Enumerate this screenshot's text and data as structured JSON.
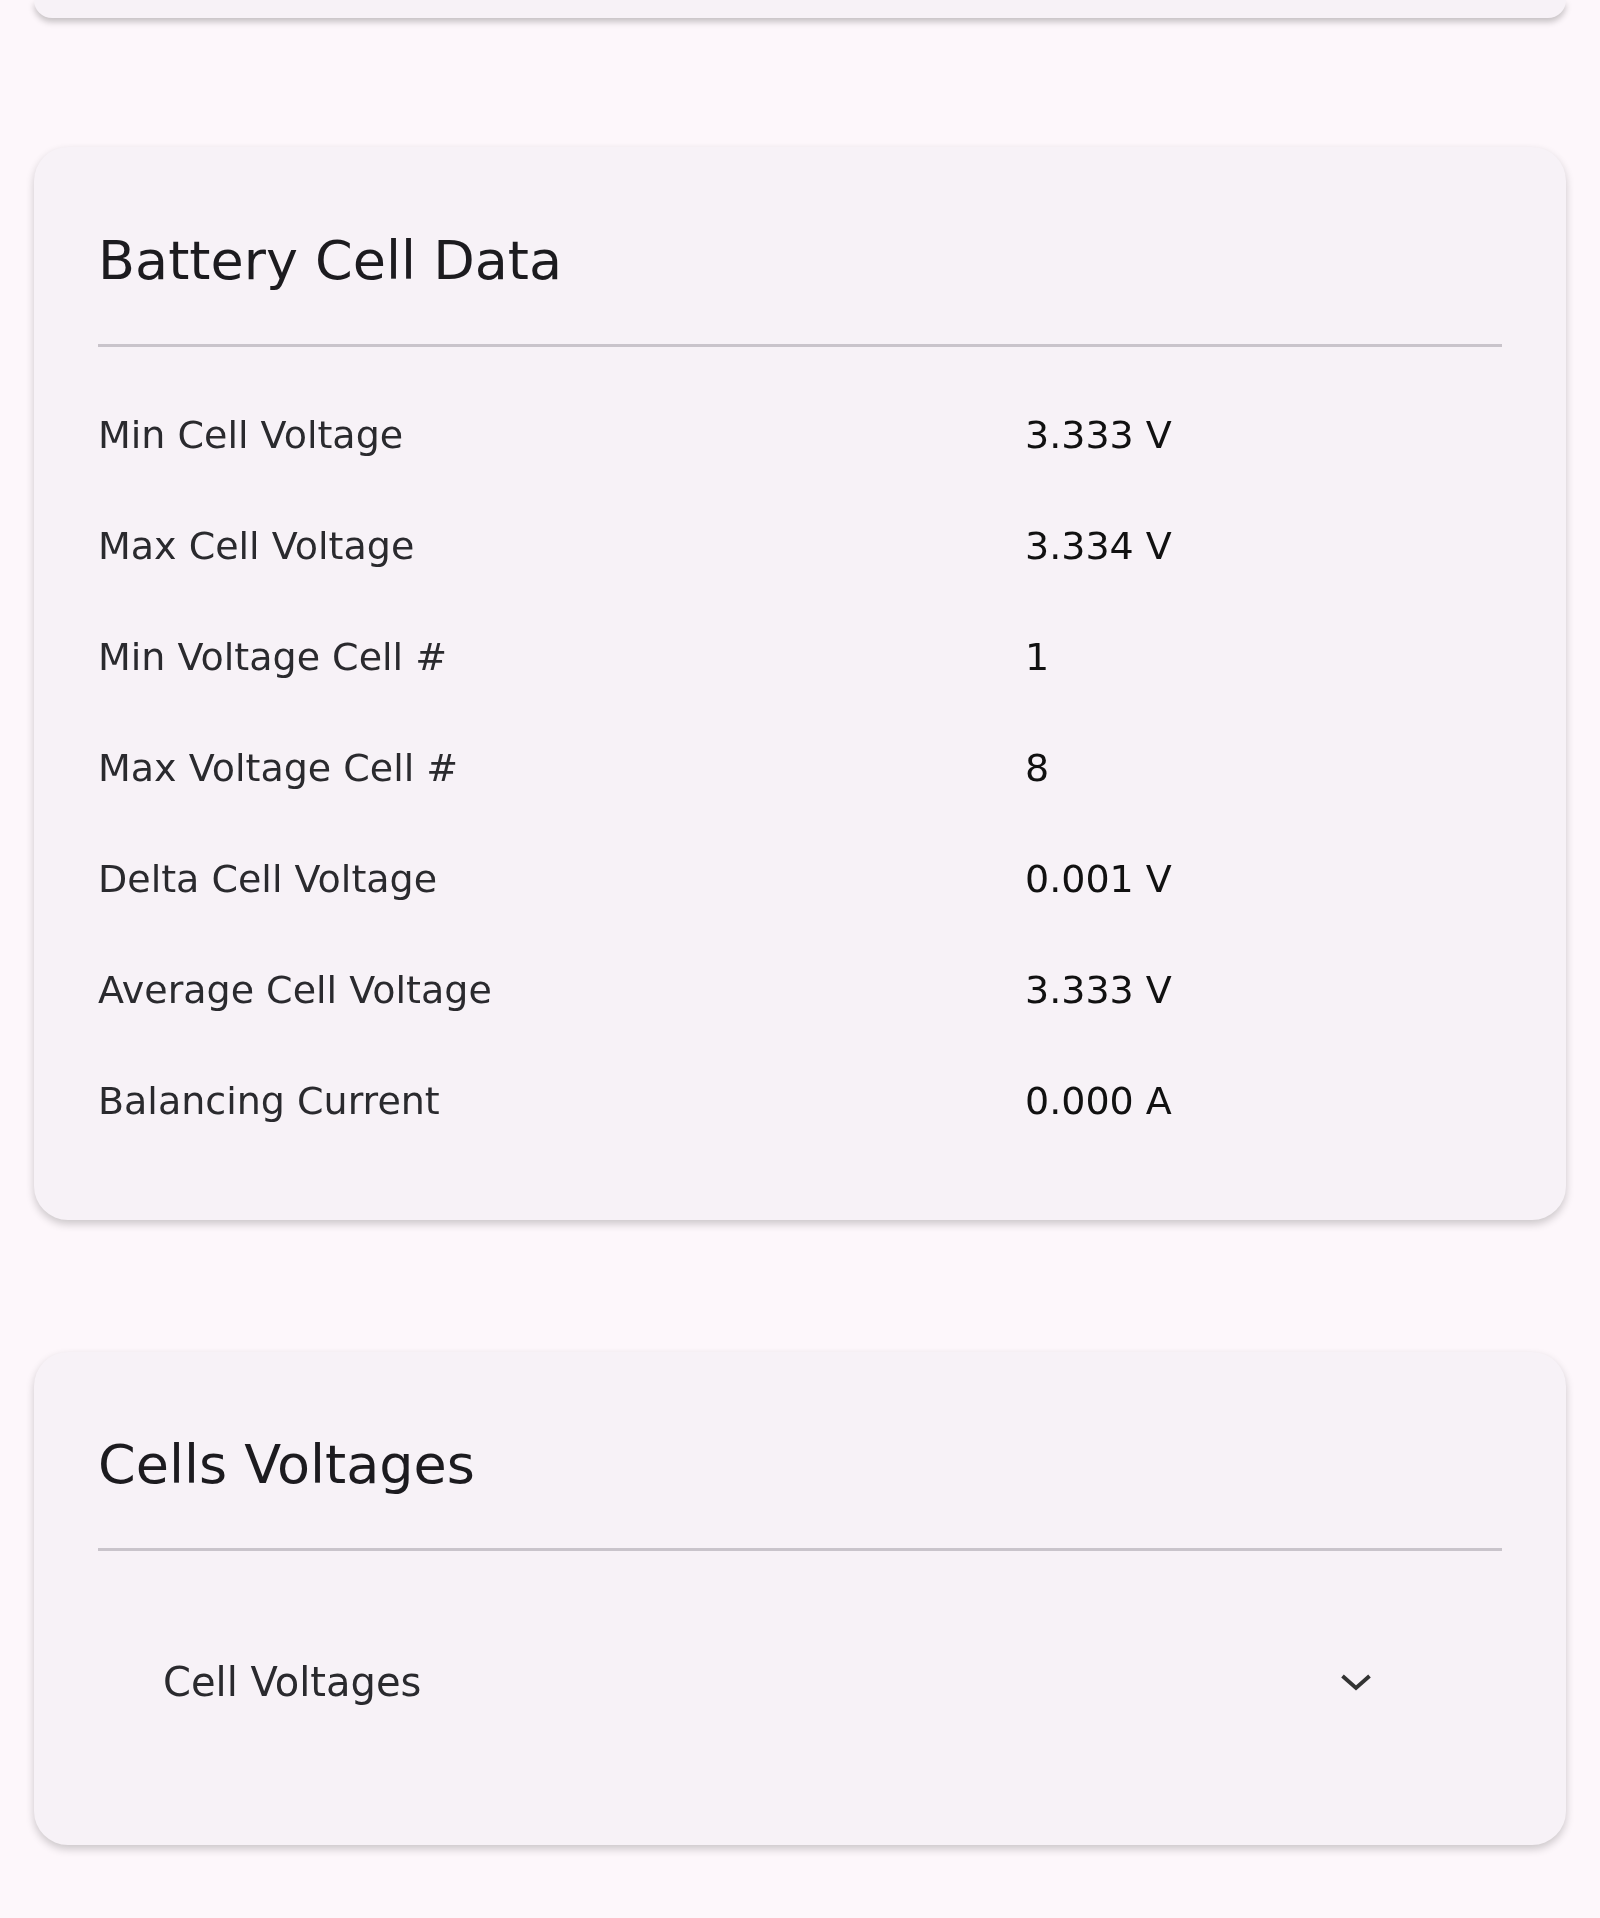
{
  "battery_cell_data": {
    "title": "Battery Cell Data",
    "rows": [
      {
        "label": "Min Cell Voltage",
        "value": "3.333 V"
      },
      {
        "label": "Max Cell Voltage",
        "value": "3.334 V"
      },
      {
        "label": "Min Voltage Cell #",
        "value": "1"
      },
      {
        "label": "Max Voltage Cell #",
        "value": "8"
      },
      {
        "label": "Delta Cell Voltage",
        "value": "0.001 V"
      },
      {
        "label": "Average Cell Voltage",
        "value": "3.333 V"
      },
      {
        "label": "Balancing Current",
        "value": "0.000 A"
      }
    ]
  },
  "cells_voltages": {
    "title": "Cells Voltages",
    "panel": {
      "label": "Cell Voltages",
      "expanded": false
    }
  }
}
